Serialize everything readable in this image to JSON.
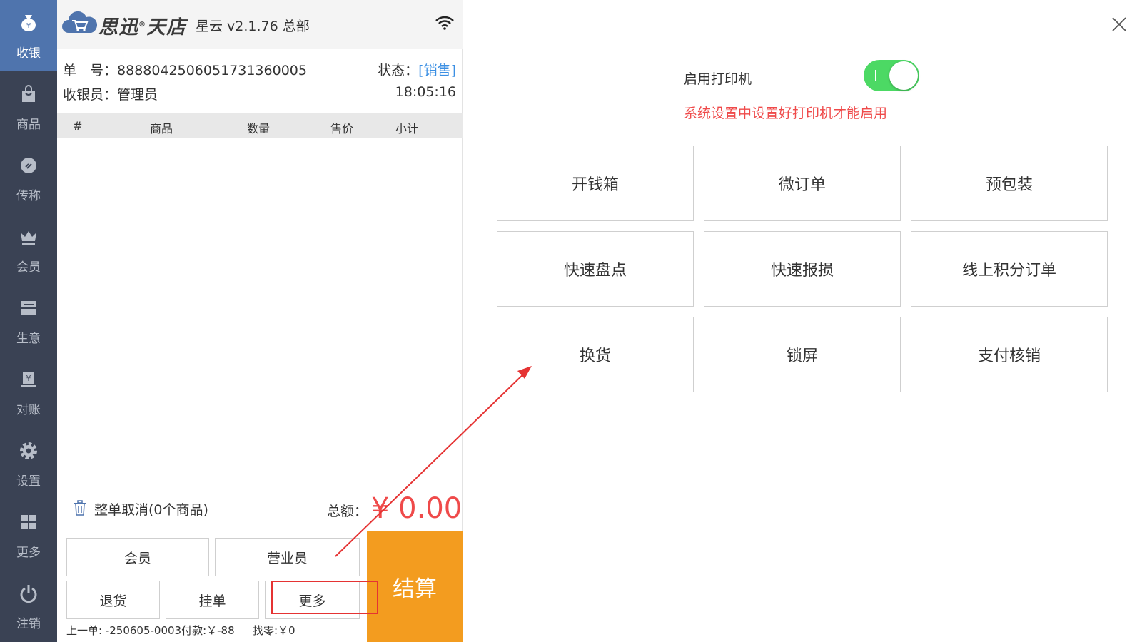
{
  "sidebar": {
    "items": [
      {
        "label": "收银",
        "icon": "cash-bag-icon"
      },
      {
        "label": "商品",
        "icon": "shopping-bag-icon"
      },
      {
        "label": "传称",
        "icon": "scale-icon"
      },
      {
        "label": "会员",
        "icon": "crown-icon"
      },
      {
        "label": "生意",
        "icon": "ledger-icon"
      },
      {
        "label": "对账",
        "icon": "reconcile-icon"
      },
      {
        "label": "设置",
        "icon": "gear-icon"
      },
      {
        "label": "更多",
        "icon": "grid-icon"
      },
      {
        "label": "注销",
        "icon": "power-icon"
      }
    ]
  },
  "header": {
    "brand": "思迅",
    "brand_mark": "®",
    "brand2": "天店",
    "version": "星云 v2.1.76  总部"
  },
  "order": {
    "number_label": "单　号：",
    "number": "8888042506051731360005",
    "status_label": "状态：",
    "status_value": "[销售]",
    "cashier_label": "收银员：",
    "cashier": "管理员",
    "time": "18:05:16"
  },
  "table": {
    "columns": [
      "#",
      "商品",
      "数量",
      "售价",
      "小计"
    ]
  },
  "footer": {
    "cancel_all": "整单取消(0个商品)",
    "total_label": "总额：",
    "total_value": "¥ 0.00",
    "buttons": {
      "member": "会员",
      "salesperson": "营业员",
      "return": "退货",
      "hold": "挂单",
      "more": "更多",
      "settle": "结算"
    },
    "last_order": "上一单: -250605-0003付款:￥-88",
    "change": "找零:￥0"
  },
  "more_panel": {
    "printer_label": "启用打印机",
    "printer_enabled": true,
    "printer_warning": "系统设置中设置好打印机才能启用",
    "functions": [
      "开钱箱",
      "微订单",
      "预包装",
      "快速盘点",
      "快速报损",
      "线上积分订单",
      "换货",
      "锁屏",
      "支付核销"
    ]
  },
  "colors": {
    "sidebar_bg": "#3a4254",
    "sidebar_active": "#4f74ad",
    "accent_orange": "#f39c1f",
    "price_red": "#ef4a4a",
    "status_blue": "#3b8fe3",
    "toggle_green": "#4cd964"
  }
}
